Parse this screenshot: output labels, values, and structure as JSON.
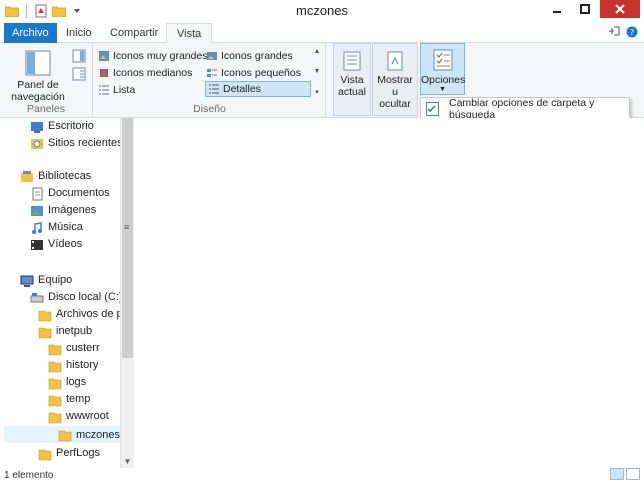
{
  "window": {
    "title": "mczones"
  },
  "tabs": {
    "archivo": "Archivo",
    "inicio": "Inicio",
    "compartir": "Compartir",
    "vista": "Vista"
  },
  "ribbon": {
    "paneles": {
      "panel_navegacion_line1": "Panel de",
      "panel_navegacion_line2": "navegación",
      "group_label": "Paneles"
    },
    "diseno": {
      "items": [
        {
          "label": "Iconos muy grandes"
        },
        {
          "label": "Iconos grandes"
        },
        {
          "label": "Iconos medianos"
        },
        {
          "label": "Iconos pequeños"
        },
        {
          "label": "Lista"
        },
        {
          "label": "Detalles"
        }
      ],
      "group_label": "Diseño"
    },
    "vista_actual": {
      "line1": "Vista",
      "line2": "actual"
    },
    "mostrar": {
      "line1": "Mostrar u",
      "line2": "ocultar"
    },
    "opciones": {
      "label": "Opciones"
    }
  },
  "dropdown": {
    "item": "Cambiar opciones de carpeta y búsqueda"
  },
  "nav": {
    "items": [
      {
        "label": "Escritorio"
      },
      {
        "label": "Sitios recientes"
      },
      {
        "label": "Bibliotecas"
      },
      {
        "label": "Documentos"
      },
      {
        "label": "Imágenes"
      },
      {
        "label": "Música"
      },
      {
        "label": "Vídeos"
      },
      {
        "label": "Equipo"
      },
      {
        "label": "Disco local (C:)"
      },
      {
        "label": "Archivos de pro"
      },
      {
        "label": "inetpub"
      },
      {
        "label": "custerr"
      },
      {
        "label": "history"
      },
      {
        "label": "logs"
      },
      {
        "label": "temp"
      },
      {
        "label": "wwwroot"
      },
      {
        "label": "mczones"
      },
      {
        "label": "PerfLogs"
      }
    ]
  },
  "status": {
    "count": "1 elemento"
  },
  "colors": {
    "accent": "#1979ca",
    "close_button": "#c7312e",
    "selection": "#cde6f7",
    "folder": "#f3c243"
  }
}
